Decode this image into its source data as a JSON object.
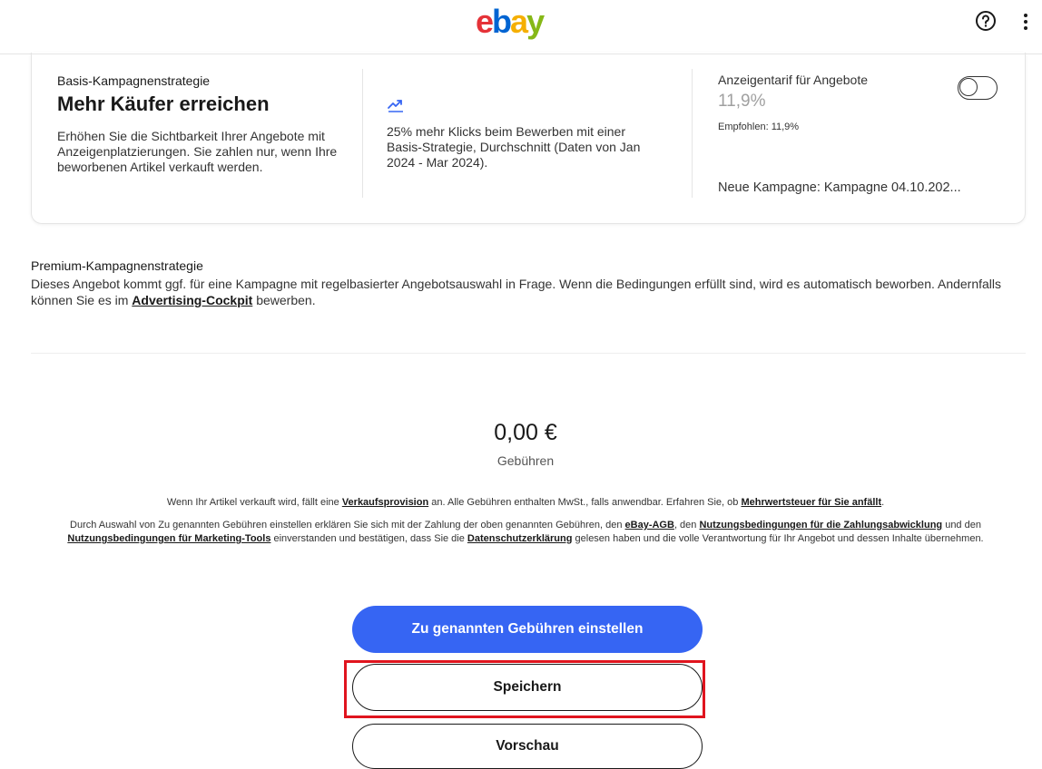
{
  "header": {
    "logo": [
      "e",
      "b",
      "a",
      "y"
    ]
  },
  "basis": {
    "eyebrow": "Basis-Kampagnenstrategie",
    "title": "Mehr Käufer erreichen",
    "description": "Erhöhen Sie die Sichtbarkeit Ihrer Angebote mit Anzeigenplatzierungen. Sie zahlen nur, wenn Ihre beworbenen Artikel verkauft werden.",
    "trend_icon": "trending-up-icon",
    "trend_text": "25% mehr Klicks beim Bewerben mit einer Basis-Strategie, Durchschnitt (Daten von Jan 2024 - Mar 2024).",
    "rate_label": "Anzeigentarif für Angebote",
    "rate_value": "11,9%",
    "rate_recommended": "Empfohlen: 11,9%",
    "toggle_on": false,
    "new_campaign": "Neue Kampagne: Kampagne 04.10.202..."
  },
  "premium": {
    "title": "Premium-Kampagnenstrategie",
    "text_before": "Dieses Angebot kommt ggf. für eine Kampagne mit regelbasierter Angebotsauswahl in Frage. Wenn die Bedingungen erfüllt sind, wird es automatisch beworben. Andernfalls können Sie es im ",
    "link": "Advertising-Cockpit",
    "text_after": " bewerben."
  },
  "fees": {
    "amount": "0,00 €",
    "label": "Gebühren"
  },
  "legal": {
    "line1_a": "Wenn Ihr Artikel verkauft wird, fällt eine ",
    "line1_link1": "Verkaufsprovision",
    "line1_b": " an. Alle Gebühren enthalten MwSt., falls anwendbar. Erfahren Sie, ob ",
    "line1_link2": "Mehrwertsteuer für Sie anfällt",
    "line1_c": ".",
    "line2_a": "Durch Auswahl von Zu genannten Gebühren einstellen erklären Sie sich mit der Zahlung der oben genannten Gebühren, den ",
    "line2_link1": "eBay-AGB",
    "line2_b": ", den ",
    "line2_link2": "Nutzungsbedingungen für die Zahlungsabwicklung",
    "line2_c": " und den ",
    "line2_link3": "Nutzungsbedingungen für Marketing-Tools",
    "line2_d": " einverstanden und bestätigen, dass Sie die ",
    "line2_link4": "Datenschutzerklärung",
    "line2_e": " gelesen haben und die volle Verantwortung für Ihr Angebot und dessen Inhalte übernehmen."
  },
  "buttons": {
    "primary": "Zu genannten Gebühren einstellen",
    "save": "Speichern",
    "preview": "Vorschau"
  },
  "colors": {
    "primary_button": "#3665f3",
    "highlight": "#e0141e"
  }
}
